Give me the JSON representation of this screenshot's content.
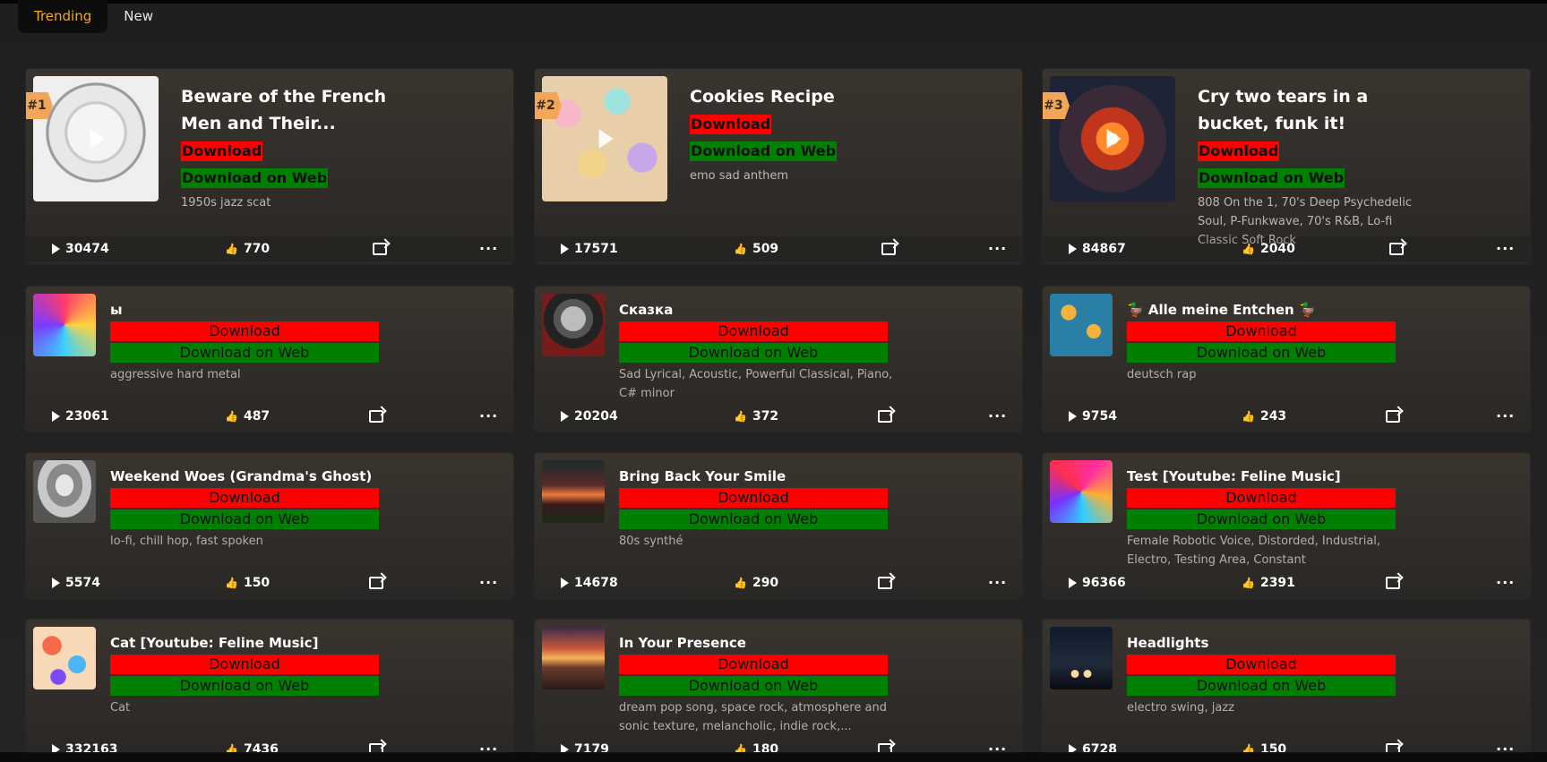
{
  "tabs": [
    {
      "label": "Trending",
      "active": true
    },
    {
      "label": "New",
      "active": false
    }
  ],
  "colors": {
    "accent": "#f5a623",
    "download": "#ff0000",
    "download_web": "#008000",
    "rank_badge": "#f2a65a"
  },
  "icons": {
    "play": "play-icon",
    "like": "thumbs-up-icon",
    "share": "share-icon",
    "more": "more-dots-icon"
  },
  "labels": {
    "download": "Download",
    "download_web": "Download on Web",
    "more": "···"
  },
  "featured": [
    {
      "rank": "#1",
      "title": "Beware of the French Men and Their...",
      "tags": "1950s jazz scat",
      "plays": "30474",
      "likes": "770"
    },
    {
      "rank": "#2",
      "title": "Cookies Recipe",
      "tags": "emo sad anthem",
      "plays": "17571",
      "likes": "509"
    },
    {
      "rank": "#3",
      "title": "Cry two tears in a bucket, funk it!",
      "tags": "808 On the 1, 70's Deep Psychedelic Soul, P-Funkwave, 70's R&B, Lo-fi Classic Soft Rock",
      "plays": "84867",
      "likes": "2040"
    }
  ],
  "songs": [
    {
      "title": "ы",
      "tags": "aggressive hard metal",
      "plays": "23061",
      "likes": "487"
    },
    {
      "title": "Сказка",
      "tags": "Sad Lyrical, Acoustic, Powerful Classical, Piano, C# minor",
      "plays": "20204",
      "likes": "372"
    },
    {
      "title": "🦆 Alle meine Entchen 🦆",
      "tags": "deutsch rap",
      "plays": "9754",
      "likes": "243"
    },
    {
      "title": "Weekend Woes (Grandma's Ghost)",
      "tags": "lo-fi, chill hop, fast spoken",
      "plays": "5574",
      "likes": "150"
    },
    {
      "title": "Bring Back Your Smile",
      "tags": "80s synthé",
      "plays": "14678",
      "likes": "290"
    },
    {
      "title": "Test [Youtube: Feline Music]",
      "tags": "Female Robotic Voice, Distorded, Industrial, Electro, Testing Area, Constant",
      "plays": "96366",
      "likes": "2391"
    },
    {
      "title": "Cat [Youtube: Feline Music]",
      "tags": "Cat",
      "plays": "332163",
      "likes": "7436"
    },
    {
      "title": "In Your Presence",
      "tags": "dream pop song, space rock, atmosphere and sonic texture, melancholic, indie rock,...",
      "plays": "7179",
      "likes": "180"
    },
    {
      "title": "Headlights",
      "tags": "electro swing, jazz",
      "plays": "6728",
      "likes": "150"
    }
  ]
}
